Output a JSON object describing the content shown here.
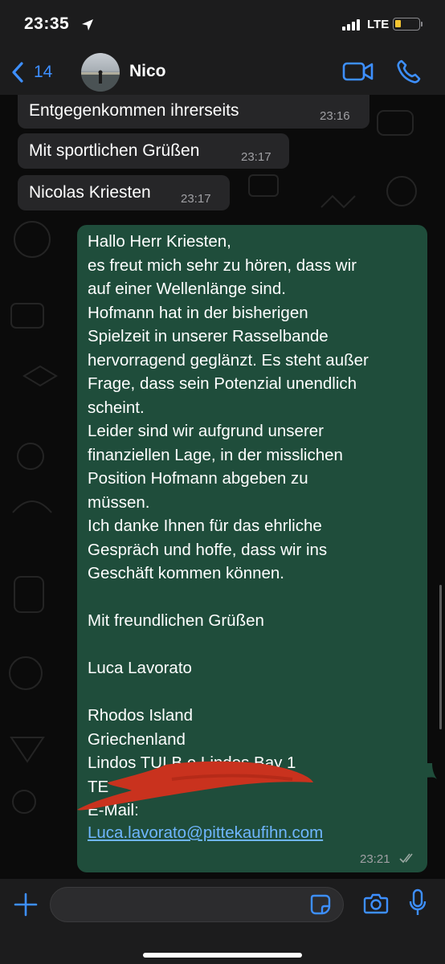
{
  "status_bar": {
    "time": "23:35",
    "network": "LTE",
    "battery_level": 0.25,
    "battery_color": "#f4c430"
  },
  "nav": {
    "back_count": "14",
    "contact_name": "Nico",
    "accent_color": "#3d8fff",
    "icons": [
      "chevron-left-icon",
      "video-camera-icon",
      "phone-icon"
    ]
  },
  "incoming_messages": [
    {
      "text": "Entgegenkommen ihrerseits",
      "time": "23:16"
    },
    {
      "text": "Mit sportlichen Grüßen",
      "time": "23:17"
    },
    {
      "text": "Nicolas Kriesten",
      "time": "23:17"
    }
  ],
  "outgoing_message": {
    "lines": [
      "Hallo Herr Kriesten,",
      "es freut mich sehr zu hören, dass wir",
      "auf einer Wellenlänge sind.",
      "Hofmann hat in der bisherigen",
      "Spielzeit in unserer Rasselbande",
      "hervorragend geglänzt. Es steht außer",
      "Frage, dass sein Potenzial unendlich",
      "scheint.",
      "Leider sind wir aufgrund unserer",
      "finanziellen Lage, in der misslichen",
      "Position Hofmann abgeben zu",
      "müssen.",
      "Ich danke Ihnen für das ehrliche",
      "Gespräch und hoffe, dass wir ins",
      "Geschäft kommen können.",
      "",
      "Mit freundlichen Grüßen",
      "",
      "Luca Lavorato",
      "",
      "Rhodos Island",
      "Griechenland",
      "Lindos TUI B   e Lindos Bay 1",
      "TE",
      "E-Mail:"
    ],
    "email_link": "Luca.lavorato@pittekaufihn.com",
    "time": "23:21",
    "status": "read",
    "bubble_color": "#1f4d3b"
  },
  "input": {
    "placeholder": "",
    "icons": [
      "plus-icon",
      "sticker-icon",
      "camera-icon",
      "microphone-icon"
    ]
  }
}
